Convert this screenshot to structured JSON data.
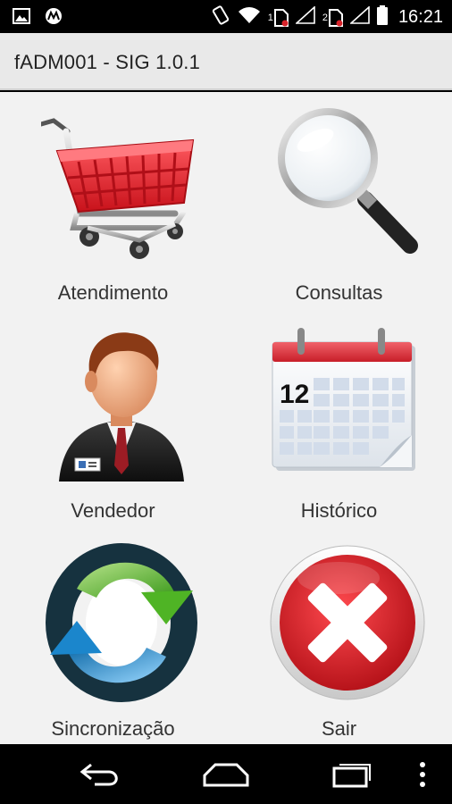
{
  "status_bar": {
    "time": "16:21",
    "sim1_label": "1",
    "sim2_label": "2",
    "icons": [
      "image-notification-icon",
      "motorola-icon",
      "rotate-icon",
      "wifi-icon",
      "sim-icon",
      "signal-icon",
      "battery-icon"
    ]
  },
  "app": {
    "title": "fADM001 - SIG 1.0.1"
  },
  "menu": [
    {
      "id": "atendimento",
      "label": "Atendimento",
      "icon": "shopping-cart-icon"
    },
    {
      "id": "consultas",
      "label": "Consultas",
      "icon": "magnifier-icon"
    },
    {
      "id": "vendedor",
      "label": "Vendedor",
      "icon": "salesman-icon"
    },
    {
      "id": "historico",
      "label": "Histórico",
      "icon": "calendar-icon"
    },
    {
      "id": "sincronizacao",
      "label": "Sincronização",
      "icon": "sync-icon"
    },
    {
      "id": "sair",
      "label": "Sair",
      "icon": "close-icon"
    }
  ],
  "calendar": {
    "day": "12"
  },
  "colors": {
    "action_bar": "#e9e9e9",
    "content_bg": "#f2f2f2",
    "cart_red": "#e8222c",
    "exit_red": "#d81c22",
    "sync_green": "#5cb82e",
    "sync_blue": "#1f8fd0"
  }
}
